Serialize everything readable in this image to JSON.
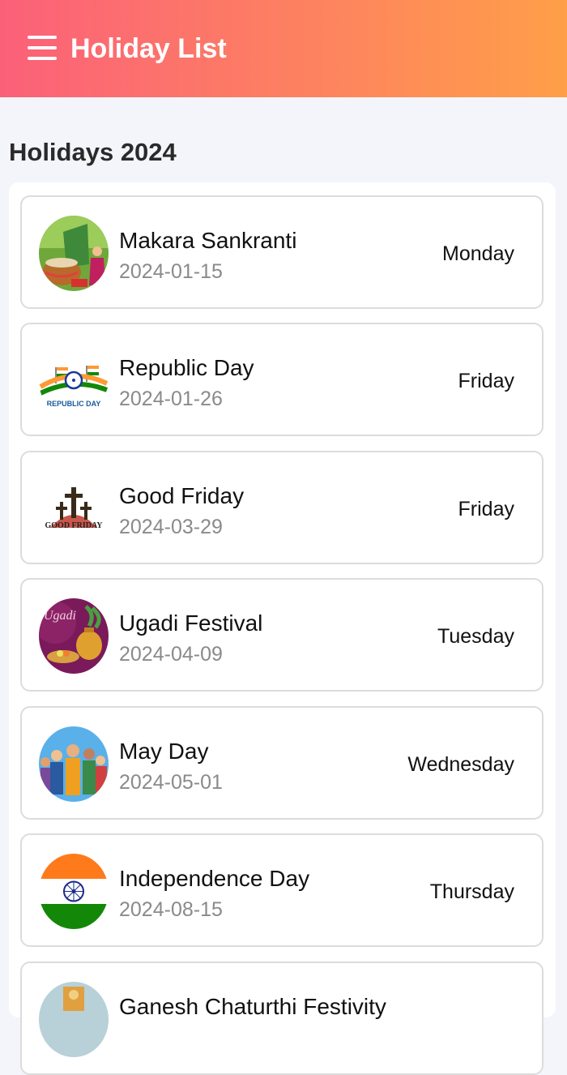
{
  "header": {
    "title": "Holiday List",
    "menu_icon": "hamburger-menu-icon"
  },
  "section": {
    "title": "Holidays 2024"
  },
  "colors": {
    "header_gradient": [
      "#fb6079",
      "#ff9f48"
    ],
    "background": "#f4f5fa",
    "date_text": "#8a8a8a"
  },
  "holidays": [
    {
      "name": "Makara Sankranti",
      "date": "2024-01-15",
      "day": "Monday",
      "icon": "makara-sankranti-icon"
    },
    {
      "name": "Republic Day",
      "date": "2024-01-26",
      "day": "Friday",
      "icon": "republic-day-icon",
      "icon_text": "REPUBLIC DAY"
    },
    {
      "name": "Good Friday",
      "date": "2024-03-29",
      "day": "Friday",
      "icon": "good-friday-icon",
      "icon_text": "GOOD FRIDAY"
    },
    {
      "name": "Ugadi Festival",
      "date": "2024-04-09",
      "day": "Tuesday",
      "icon": "ugadi-festival-icon",
      "icon_text": "Ugadi"
    },
    {
      "name": "May Day",
      "date": "2024-05-01",
      "day": "Wednesday",
      "icon": "may-day-icon"
    },
    {
      "name": "Independence Day",
      "date": "2024-08-15",
      "day": "Thursday",
      "icon": "indian-flag-icon"
    },
    {
      "name": "Ganesh Chaturthi Festivity",
      "date": "",
      "day": "",
      "icon": "ganesh-chaturthi-icon"
    }
  ]
}
